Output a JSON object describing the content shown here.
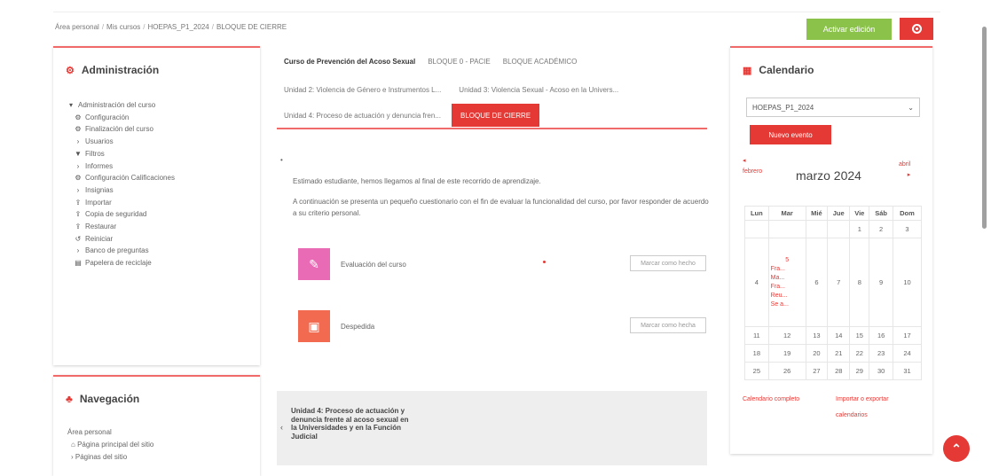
{
  "breadcrumb": [
    "Área personal",
    "Mis cursos",
    "HOEPAS_P1_2024",
    "BLOQUE DE CIERRE"
  ],
  "breadcrumb_sep": "/",
  "header": {
    "edit_label": "Activar edición",
    "gear_icon": "gear-icon"
  },
  "admin": {
    "title": "Administración",
    "root": "Administración del curso",
    "items": [
      {
        "icon": "gear-icon",
        "label": "Configuración"
      },
      {
        "icon": "gear-icon",
        "label": "Finalización del curso"
      },
      {
        "icon": "caret-right-icon",
        "label": "Usuarios"
      },
      {
        "icon": "filter-icon",
        "label": "Filtros"
      },
      {
        "icon": "caret-right-icon",
        "label": "Informes"
      },
      {
        "icon": "gear-icon",
        "label": "Configuración Calificaciones"
      },
      {
        "icon": "caret-right-icon",
        "label": "Insignias"
      },
      {
        "icon": "upload-icon",
        "label": "Importar"
      },
      {
        "icon": "upload-icon",
        "label": "Copia de seguridad"
      },
      {
        "icon": "upload-icon",
        "label": "Restaurar"
      },
      {
        "icon": "reset-icon",
        "label": "Reiniciar"
      },
      {
        "icon": "caret-right-icon",
        "label": "Banco de preguntas"
      },
      {
        "icon": "trash-icon",
        "label": "Papelera de reciclaje"
      }
    ]
  },
  "nav": {
    "title": "Navegación",
    "items": [
      "Área personal",
      "Página principal del sitio",
      "Páginas del sitio"
    ]
  },
  "tabs": [
    "Curso de Prevención del Acoso Sexual",
    "BLOQUE 0 - PACIE",
    "BLOQUE ACADÉMICO"
  ],
  "units_row1": [
    "Unidad 2: Violencia de Género e Instrumentos L...",
    "Unidad 3: Violencia Sexual - Acoso en la Univers..."
  ],
  "units_row2": [
    "Unidad 4: Proceso de actuación y denuncia fren...",
    "BLOQUE DE CIERRE"
  ],
  "intro1": "Estimado estudiante, hemos llegamos al final de este recorrido de aprendizaje.",
  "intro2": "A continuación se presenta un pequeño cuestionario con el fin de evaluar la funcionalidad del curso, por favor responder de acuerdo a su criterio personal.",
  "activities": [
    {
      "name": "Evaluación del curso",
      "button": "Marcar como hecho",
      "color": "#e96bb5"
    },
    {
      "name": "Despedida",
      "button": "Marcar como hecha",
      "color": "#f26a50"
    }
  ],
  "next_unit": "Unidad 4: Proceso de actuación y denuncia frente al acoso sexual en la Universidades y en la Función Judicial",
  "calendar": {
    "title": "Calendario",
    "course_select": "HOEPAS_P1_2024",
    "new_event": "Nuevo evento",
    "prev": "febrero",
    "next": "abril",
    "month": "marzo 2024",
    "days": [
      "Lun",
      "Mar",
      "Mié",
      "Jue",
      "Vie",
      "Sáb",
      "Dom"
    ],
    "week1": [
      "",
      "",
      "",
      "",
      "1",
      "2",
      "3"
    ],
    "week2_day": "4",
    "week2_tue": "5",
    "events": [
      "Fra...",
      "Ma...",
      "Fra...",
      "Reu...",
      "Se a..."
    ],
    "week2_rest": [
      "6",
      "7",
      "8",
      "9",
      "10"
    ],
    "week3": [
      "11",
      "12",
      "13",
      "14",
      "15",
      "16",
      "17"
    ],
    "week4": [
      "18",
      "19",
      "20",
      "21",
      "22",
      "23",
      "24"
    ],
    "week5": [
      "25",
      "26",
      "27",
      "28",
      "29",
      "30",
      "31"
    ],
    "link_full": "Calendario completo",
    "link_import": "Importar o exportar calendarios"
  }
}
